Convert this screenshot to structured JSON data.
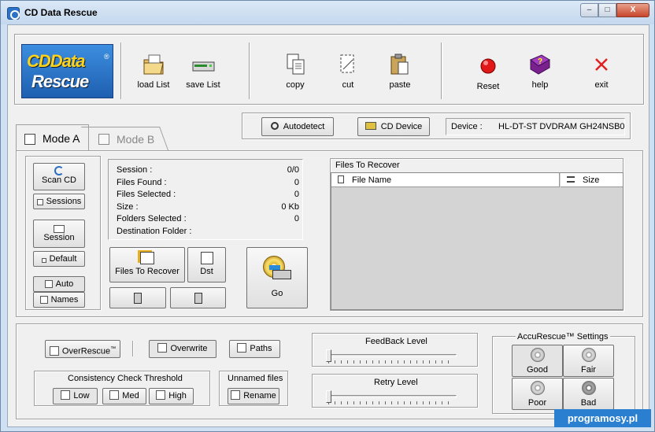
{
  "window": {
    "title": "CD Data Rescue",
    "min": "–",
    "max": "□",
    "close": "X"
  },
  "logo": {
    "line1": "CDData",
    "line2": "Rescue",
    "mark": "®"
  },
  "toolbar": {
    "load": "load List",
    "save": "save List",
    "copy": "copy",
    "cut": "cut",
    "paste": "paste",
    "reset": "Reset",
    "help": "help",
    "exit": "exit"
  },
  "drive": {
    "autodetect": "Autodetect",
    "cd_device": "CD Device",
    "device_label": "Device :",
    "device_value": "HL-DT-ST DVDRAM GH24NSB0"
  },
  "tabs": {
    "mode_a": "Mode A",
    "mode_b": "Mode B"
  },
  "left": {
    "scan": "Scan CD",
    "sessions": "Sessions",
    "session": "Session",
    "default": "Default",
    "auto": "Auto",
    "names": "Names"
  },
  "stats": [
    {
      "label": "Session :",
      "value": "0/0"
    },
    {
      "label": "Files Found :",
      "value": "0"
    },
    {
      "label": "Files Selected :",
      "value": "0"
    },
    {
      "label": "Size :",
      "value": "0 Kb"
    },
    {
      "label": "Folders Selected :",
      "value": "0"
    },
    {
      "label": "Destination Folder :",
      "value": ""
    }
  ],
  "actions": {
    "files_to_recover": "Files To Recover",
    "dst": "Dst",
    "go": "Go"
  },
  "recover": {
    "title": "Files To Recover",
    "col_name": "File Name",
    "col_size": "Size"
  },
  "bottom": {
    "overrescue": "OverRescue",
    "tm": "™",
    "overwrite": "Overwrite",
    "paths": "Paths",
    "consistency": "Consistency Check Threshold",
    "low": "Low",
    "med": "Med",
    "high": "High",
    "unnamed": "Unnamed files",
    "rename": "Rename"
  },
  "sliders": {
    "feedback": "FeedBack Level",
    "retry": "Retry Level",
    "feedback_level": 0,
    "retry_level": 0
  },
  "accurescue": {
    "title": "AccuRescue™ Settings",
    "good": "Good",
    "fair": "Fair",
    "poor": "Poor",
    "bad": "Bad"
  },
  "watermark": "programosy.pl"
}
